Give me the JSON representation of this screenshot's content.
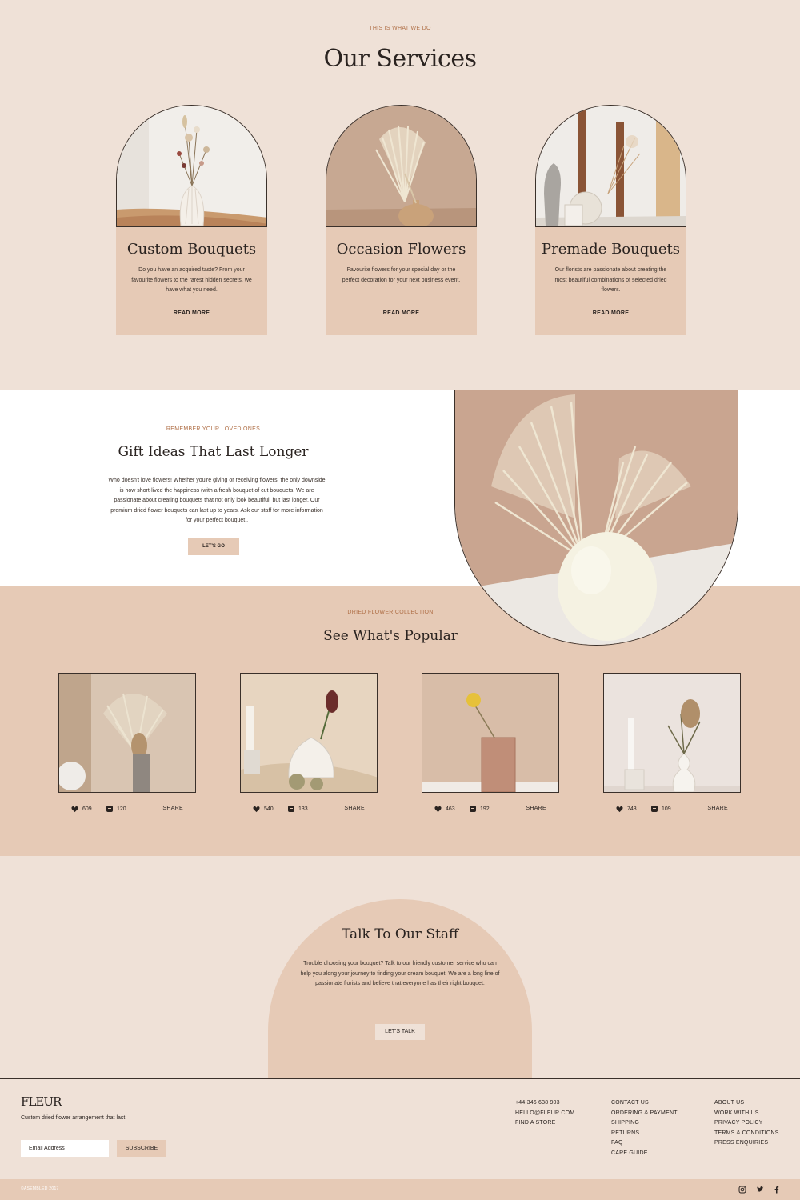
{
  "services": {
    "eyebrow": "THIS IS WHAT WE DO",
    "title": "Our Services",
    "cards": [
      {
        "title": "Custom Bouquets",
        "desc": "Do you have an acquired taste? From your favourite flowers to the rarest hidden secrets, we have what you need.",
        "link": "READ MORE"
      },
      {
        "title": "Occasion Flowers",
        "desc": "Favourite flowers for your special day or the perfect decoration for your next business event.",
        "link": "READ MORE"
      },
      {
        "title": "Premade Bouquets",
        "desc": "Our florists are passionate about creating the most beautiful combinations of selected dried flowers.",
        "link": "READ MORE"
      }
    ]
  },
  "gift": {
    "eyebrow": "REMEMBER YOUR LOVED ONES",
    "title": "Gift Ideas That Last Longer",
    "body": "Who doesn't love flowers! Whether you're giving or receiving flowers, the only downside is how short-lived the happiness (with a fresh bouquet of cut bouquets. We are passionate about creating bouquets that not only look beautiful, but last longer. Our premium dried flower bouquets can last up to years. Ask our staff for more information for your perfect bouquet..",
    "button": "LET'S GO"
  },
  "popular": {
    "eyebrow": "DRIED FLOWER COLLECTION",
    "title": "See What's Popular",
    "products": [
      {
        "likes": "609",
        "comments": "120",
        "share": "SHARE"
      },
      {
        "likes": "540",
        "comments": "133",
        "share": "SHARE"
      },
      {
        "likes": "463",
        "comments": "192",
        "share": "SHARE"
      },
      {
        "likes": "743",
        "comments": "109",
        "share": "SHARE"
      }
    ]
  },
  "staff": {
    "title": "Talk To Our Staff",
    "body": "Trouble choosing your bouquet? Talk to our friendly customer service who can help you along your journey to finding your dream bouquet. We are a long line of passionate florists and believe that everyone has their right bouquet.",
    "button": "LET'S TALK"
  },
  "footer": {
    "logo": "FLEUR",
    "tagline": "Custom dried flower arrangement that last.",
    "email_placeholder": "Email Address",
    "subscribe": "SUBSCRIBE",
    "contact": [
      "+44 346 638 903",
      "HELLO@FLEUR.COM",
      "FIND A STORE"
    ],
    "help": [
      "CONTACT US",
      "ORDERING & PAYMENT",
      "SHIPPING",
      "RETURNS",
      "FAQ",
      "CARE GUIDE"
    ],
    "about": [
      "ABOUT US",
      "WORK WITH US",
      "PRIVACY POLICY",
      "TERMS & CONDITIONS",
      "PRESS ENQUIRIES"
    ],
    "copyright": "©ASEMBLED 2017"
  },
  "icons": [
    "instagram-icon",
    "twitter-icon",
    "facebook-icon",
    "heart-icon",
    "comment-icon"
  ],
  "colors": {
    "background": "#efe1d7",
    "accent": "#e6cab6",
    "eyebrow": "#b07048",
    "text": "#2a2320"
  }
}
